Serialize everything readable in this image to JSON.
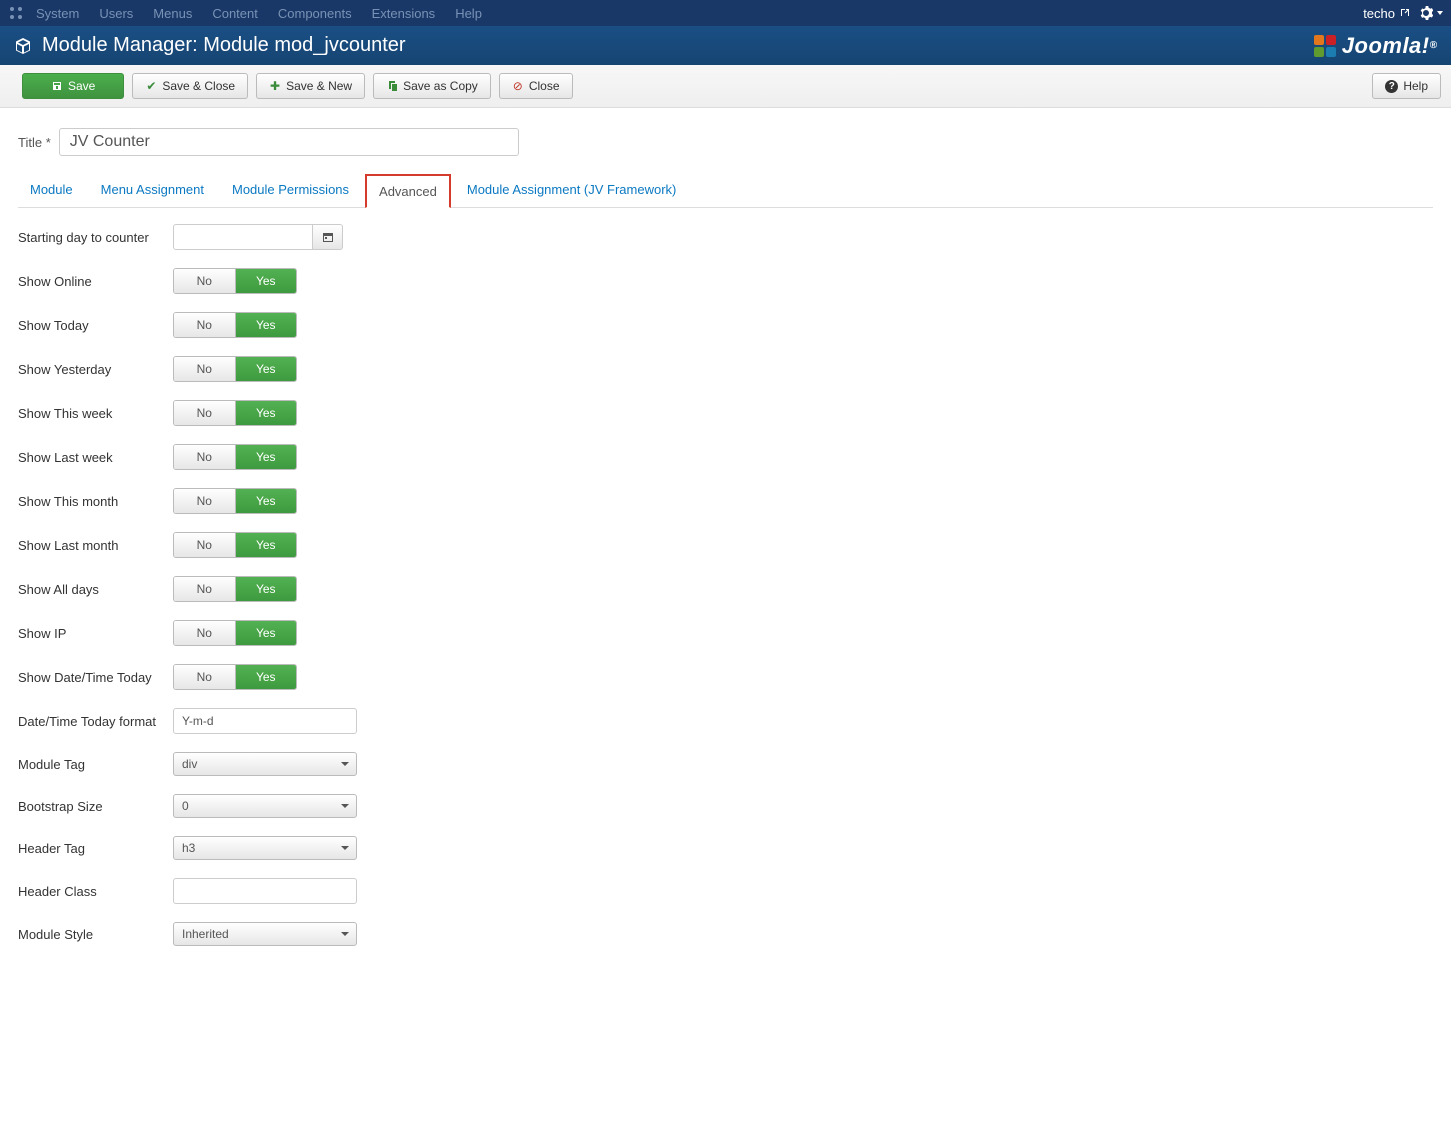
{
  "topnav": {
    "items": [
      "System",
      "Users",
      "Menus",
      "Content",
      "Components",
      "Extensions",
      "Help"
    ],
    "user": "techo"
  },
  "header": {
    "title": "Module Manager: Module mod_jvcounter",
    "logo": "Joomla!"
  },
  "toolbar": {
    "save": "Save",
    "save_close": "Save & Close",
    "save_new": "Save & New",
    "save_copy": "Save as Copy",
    "close": "Close",
    "help": "Help"
  },
  "title": {
    "label": "Title *",
    "value": "JV Counter"
  },
  "tabs": {
    "items": [
      "Module",
      "Menu Assignment",
      "Module Permissions",
      "Advanced",
      "Module Assignment (JV Framework)"
    ],
    "active": 3
  },
  "form": {
    "starting_day": {
      "label": "Starting day to counter",
      "value": ""
    },
    "toggles": [
      {
        "label": "Show Online",
        "no": "No",
        "yes": "Yes"
      },
      {
        "label": "Show Today",
        "no": "No",
        "yes": "Yes"
      },
      {
        "label": "Show Yesterday",
        "no": "No",
        "yes": "Yes"
      },
      {
        "label": "Show This week",
        "no": "No",
        "yes": "Yes"
      },
      {
        "label": "Show Last week",
        "no": "No",
        "yes": "Yes"
      },
      {
        "label": "Show This month",
        "no": "No",
        "yes": "Yes"
      },
      {
        "label": "Show Last month",
        "no": "No",
        "yes": "Yes"
      },
      {
        "label": "Show All days",
        "no": "No",
        "yes": "Yes"
      },
      {
        "label": "Show IP",
        "no": "No",
        "yes": "Yes"
      },
      {
        "label": "Show Date/Time Today",
        "no": "No",
        "yes": "Yes"
      }
    ],
    "datetime_format": {
      "label": "Date/Time Today format",
      "value": "Y-m-d"
    },
    "module_tag": {
      "label": "Module Tag",
      "value": "div"
    },
    "bootstrap_size": {
      "label": "Bootstrap Size",
      "value": "0"
    },
    "header_tag": {
      "label": "Header Tag",
      "value": "h3"
    },
    "header_class": {
      "label": "Header Class",
      "value": ""
    },
    "module_style": {
      "label": "Module Style",
      "value": "Inherited"
    }
  }
}
